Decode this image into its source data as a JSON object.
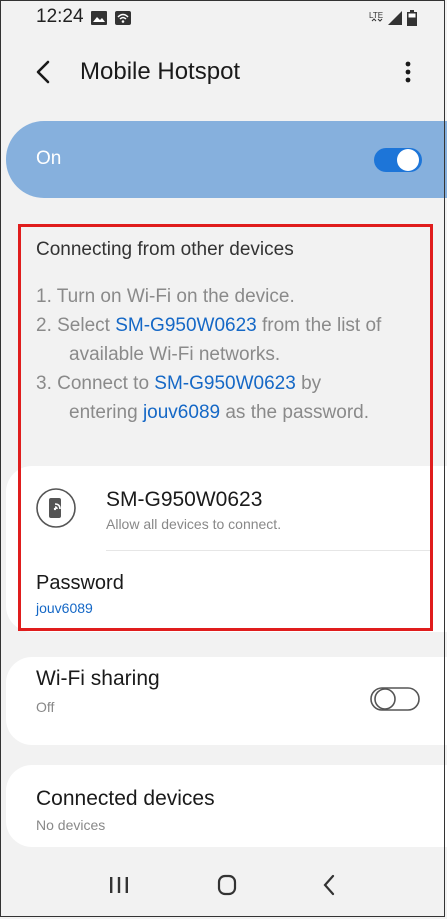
{
  "status_bar": {
    "time": "12:24",
    "icons": [
      "image-icon",
      "wifi-status-icon",
      "lte-icon",
      "signal-icon",
      "battery-icon"
    ]
  },
  "header": {
    "title": "Mobile Hotspot",
    "back_icon": "chevron-left-icon",
    "menu_icon": "more-vertical-icon"
  },
  "master_switch": {
    "label": "On",
    "enabled": true
  },
  "instructions": {
    "title": "Connecting from other devices",
    "step1": "1. Turn on Wi-Fi on the device.",
    "step2_pre": "2. Select ",
    "step2_link": "SM-G950W0623",
    "step2_post": " from the list of",
    "step2_line2": "available Wi-Fi networks.",
    "step3_pre": "3. Connect to ",
    "step3_link": "SM-G950W0623",
    "step3_post": " by",
    "step3_line2_pre": "entering ",
    "step3_line2_link": "jouv6089",
    "step3_line2_post": " as the password."
  },
  "network": {
    "ssid": "SM-G950W0623",
    "subtitle": "Allow all devices to connect.",
    "password_label": "Password",
    "password_value": "jouv6089"
  },
  "wifi_sharing": {
    "title": "Wi-Fi sharing",
    "status": "Off",
    "enabled": false
  },
  "connected_devices": {
    "title": "Connected devices",
    "status": "No devices"
  },
  "nav_bar": {
    "icons": [
      "recent-apps-icon",
      "home-icon",
      "back-icon"
    ]
  },
  "colors": {
    "accent": "#1568c6",
    "switch_bar": "#86b0dd",
    "highlight_box": "#e01d1d"
  }
}
